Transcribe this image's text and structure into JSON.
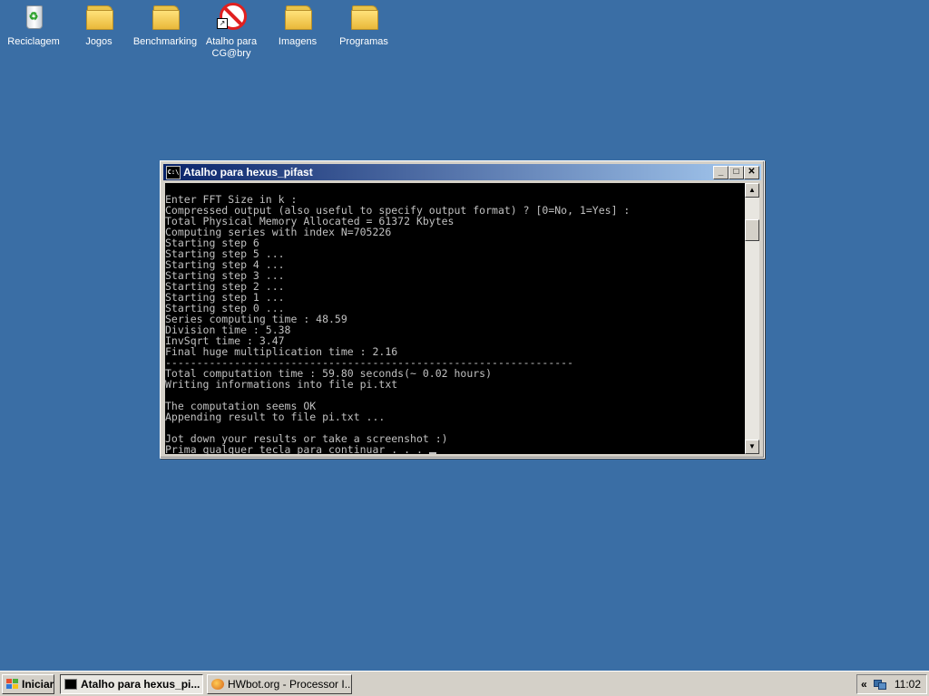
{
  "desktop": {
    "icons": [
      {
        "label": "Reciclagem",
        "icon": "recycle-bin-icon"
      },
      {
        "label": "Jogos",
        "icon": "folder-icon"
      },
      {
        "label": "Benchmarking",
        "icon": "folder-icon"
      },
      {
        "label": "Atalho para\nCG@bry",
        "icon": "no-entry-icon"
      },
      {
        "label": "Imagens",
        "icon": "folder-icon"
      },
      {
        "label": "Programas",
        "icon": "folder-icon"
      }
    ]
  },
  "window": {
    "title": "Atalho para hexus_pifast",
    "icon_text": "C:\\",
    "console_lines": [
      "Enter FFT Size in k :",
      "Compressed output (also useful to specify output format) ? [0=No, 1=Yes] :",
      "Total Physical Memory Allocated = 61372 Kbytes",
      "Computing series with index N=705226",
      "Starting step 6",
      "Starting step 5 ...",
      "Starting step 4 ...",
      "Starting step 3 ...",
      "Starting step 2 ...",
      "Starting step 1 ...",
      "Starting step 0 ...",
      "Series computing time : 48.59",
      "Division time : 5.38",
      "InvSqrt time : 3.47",
      "Final huge multiplication time : 2.16",
      "-----------------------------------------------------------------",
      "Total computation time : 59.80 seconds(~ 0.02 hours)",
      "Writing informations into file pi.txt",
      "",
      "The computation seems OK",
      "Appending result to file pi.txt ...",
      "",
      "Jot down your results or take a screenshot :)",
      "Prima qualquer tecla para continuar . . . "
    ]
  },
  "taskbar": {
    "start_label": "Iniciar",
    "tasks": [
      {
        "label": "Atalho para hexus_pi...",
        "active": true
      },
      {
        "label": "HWbot.org - Processor I...",
        "active": false
      }
    ],
    "tray_chevron": "«",
    "clock": "11:02"
  },
  "colors": {
    "desktop": "#3a6ea5",
    "title_active_start": "#0a246a",
    "title_active_end": "#a6caf0"
  }
}
